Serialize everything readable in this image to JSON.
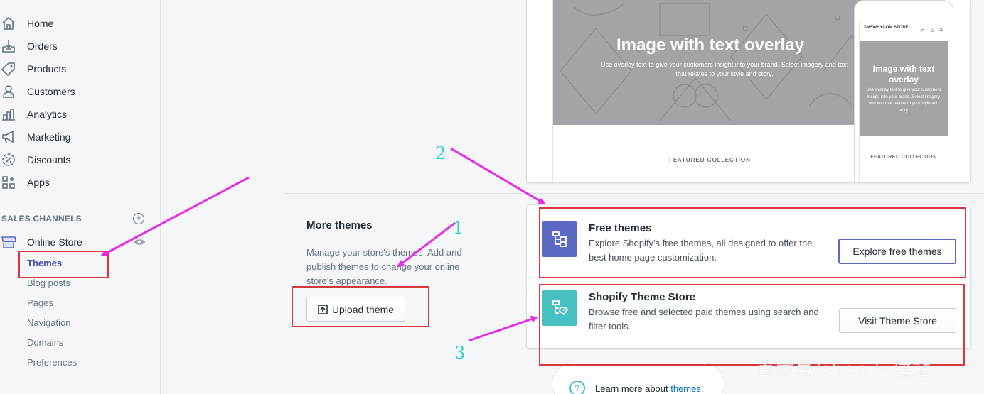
{
  "sidebar": {
    "items": [
      {
        "label": "Home",
        "icon": "home-icon"
      },
      {
        "label": "Orders",
        "icon": "orders-icon"
      },
      {
        "label": "Products",
        "icon": "tag-icon"
      },
      {
        "label": "Customers",
        "icon": "person-icon"
      },
      {
        "label": "Analytics",
        "icon": "bar-chart-icon"
      },
      {
        "label": "Marketing",
        "icon": "megaphone-icon"
      },
      {
        "label": "Discounts",
        "icon": "discount-icon"
      },
      {
        "label": "Apps",
        "icon": "apps-icon"
      }
    ],
    "sales_channels_title": "SALES CHANNELS",
    "online_store": "Online Store",
    "sub_items": [
      "Themes",
      "Blog posts",
      "Pages",
      "Navigation",
      "Domains",
      "Preferences"
    ],
    "active_sub_item": "Themes"
  },
  "preview": {
    "hero_title": "Image with text overlay",
    "hero_subtitle": "Use overlay text to give your customers insight into your brand. Select imagery and text that relates to your style and story.",
    "featured": "FEATURED COLLECTION",
    "phone_brand": "SNSWHYCOM STORE",
    "phone_nav": "⌕ ⌂ ≡",
    "phone_hero_title": "Image with text overlay",
    "phone_hero_subtitle": "Use overlay text to give your customers insight into your brand. Select imagery and text that relates to your style and story.",
    "phone_featured": "FEATURED COLLECTION"
  },
  "more_themes": {
    "title": "More themes",
    "description": "Manage your store's themes. Add and publish themes to change your online store's appearance.",
    "upload_button": "Upload theme"
  },
  "free_themes": {
    "title": "Free themes",
    "description": "Explore Shopify's free themes, all designed to offer the best home page customization.",
    "button": "Explore free themes",
    "icon_color": "#5c6ac4"
  },
  "theme_store": {
    "title": "Shopify Theme Store",
    "description": "Browse free and selected paid themes using search and filter tools.",
    "button": "Visit Theme Store",
    "icon_color": "#47c1bf"
  },
  "learn_more": {
    "prefix": "Learn more about ",
    "link": "themes",
    "suffix": "."
  },
  "annotations": {
    "n1": "1",
    "n2": "2",
    "n3": "3",
    "arrow_color": "#e62ce6",
    "box_color": "#d9363e"
  },
  "watermark": "百家号/shopify建站"
}
